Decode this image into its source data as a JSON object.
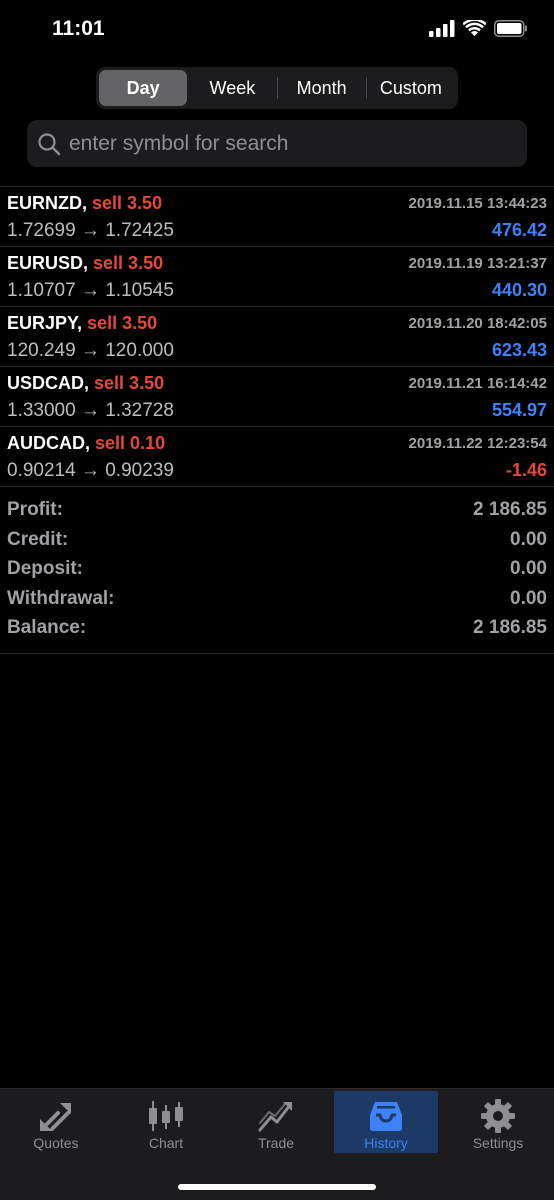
{
  "status": {
    "time": "11:01"
  },
  "segments": [
    {
      "label": "Day",
      "active": true
    },
    {
      "label": "Week",
      "active": false
    },
    {
      "label": "Month",
      "active": false
    },
    {
      "label": "Custom",
      "active": false
    }
  ],
  "search": {
    "placeholder": "enter symbol for search",
    "value": ""
  },
  "deals": [
    {
      "symbol": "EURNZD,",
      "action": "sell 3.50",
      "time": "2019.11.15 13:44:23",
      "prices": "1.72699 → 1.72425",
      "profit": "476.42",
      "profit_sign": "pos"
    },
    {
      "symbol": "EURUSD,",
      "action": "sell 3.50",
      "time": "2019.11.19 13:21:37",
      "prices": "1.10707 → 1.10545",
      "profit": "440.30",
      "profit_sign": "pos"
    },
    {
      "symbol": "EURJPY,",
      "action": "sell 3.50",
      "time": "2019.11.20 18:42:05",
      "prices": "120.249 → 120.000",
      "profit": "623.43",
      "profit_sign": "pos"
    },
    {
      "symbol": "USDCAD,",
      "action": "sell 3.50",
      "time": "2019.11.21 16:14:42",
      "prices": "1.33000 → 1.32728",
      "profit": "554.97",
      "profit_sign": "pos"
    },
    {
      "symbol": "AUDCAD,",
      "action": "sell 0.10",
      "time": "2019.11.22 12:23:54",
      "prices": "0.90214 → 0.90239",
      "profit": "-1.46",
      "profit_sign": "neg"
    }
  ],
  "summary": [
    {
      "label": "Profit:",
      "value": "2 186.85"
    },
    {
      "label": "Credit:",
      "value": "0.00"
    },
    {
      "label": "Deposit:",
      "value": "0.00"
    },
    {
      "label": "Withdrawal:",
      "value": "0.00"
    },
    {
      "label": "Balance:",
      "value": "2 186.85"
    }
  ],
  "tabs": [
    {
      "label": "Quotes",
      "icon": "quotes-icon",
      "active": false
    },
    {
      "label": "Chart",
      "icon": "candlestick-chart-icon",
      "active": false
    },
    {
      "label": "Trade",
      "icon": "trade-icon",
      "active": false
    },
    {
      "label": "History",
      "icon": "history-inbox-icon",
      "active": true
    },
    {
      "label": "Settings",
      "icon": "gear-icon",
      "active": false
    }
  ],
  "colors": {
    "accent": "#3e82f7",
    "sell": "#e5483b",
    "background": "#000000"
  }
}
